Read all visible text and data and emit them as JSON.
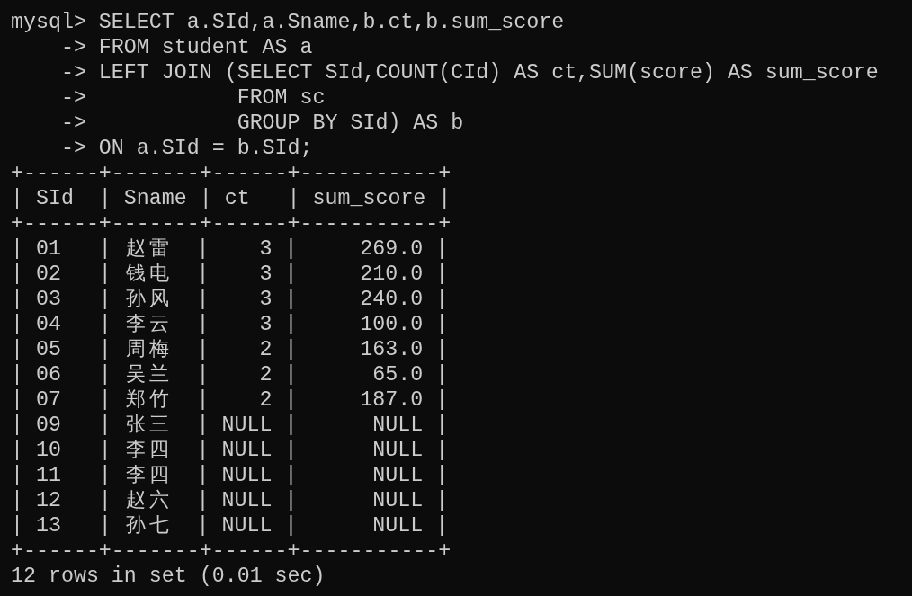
{
  "terminal": {
    "lines": [
      "mysql> SELECT a.SId,a.Sname,b.ct,b.sum_score",
      "    -> FROM student AS a",
      "    -> LEFT JOIN (SELECT SId,COUNT(CId) AS ct,SUM(score) AS sum_score",
      "    ->            FROM sc",
      "    ->            GROUP BY SId) AS b",
      "    -> ON a.SId = b.SId;",
      "+------+-------+------+-----------+",
      "| SId  | Sname | ct   | sum_score |",
      "+------+-------+------+-----------+",
      "| 01   | 赵雷  |    3 |     269.0 |",
      "| 02   | 钱电  |    3 |     210.0 |",
      "| 03   | 孙风  |    3 |     240.0 |",
      "| 04   | 李云  |    3 |     100.0 |",
      "| 05   | 周梅  |    2 |     163.0 |",
      "| 06   | 吴兰  |    2 |      65.0 |",
      "| 07   | 郑竹  |    2 |     187.0 |",
      "| 09   | 张三  | NULL |      NULL |",
      "| 10   | 李四  | NULL |      NULL |",
      "| 11   | 李四  | NULL |      NULL |",
      "| 12   | 赵六  | NULL |      NULL |",
      "| 13   | 孙七  | NULL |      NULL |",
      "+------+-------+------+-----------+",
      "12 rows in set (0.01 sec)"
    ]
  }
}
